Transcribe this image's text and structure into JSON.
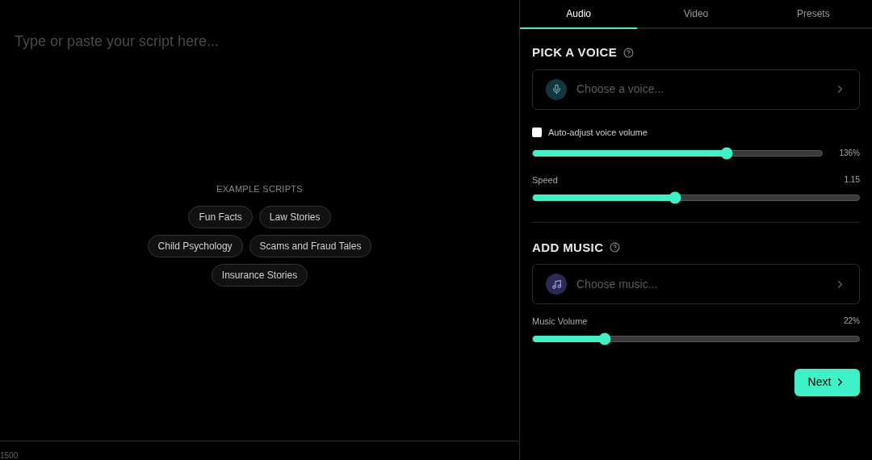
{
  "editor": {
    "placeholder": "Type or paste your script here...",
    "examples_heading": "EXAMPLE SCRIPTS",
    "examples": [
      {
        "label": "Fun Facts"
      },
      {
        "label": "Law Stories"
      },
      {
        "label": "Child Psychology"
      },
      {
        "label": "Scams and Fraud Tales"
      },
      {
        "label": "Insurance Stories"
      }
    ],
    "char_count": "1500"
  },
  "tabs": [
    {
      "label": "Audio",
      "selected": true
    },
    {
      "label": "Video",
      "selected": false
    },
    {
      "label": "Presets",
      "selected": false
    }
  ],
  "voice": {
    "heading": "PICK A VOICE",
    "picker_placeholder": "Choose a voice...",
    "auto_adjust": {
      "label": "Auto-adjust voice volume",
      "checked": false
    },
    "volume": {
      "level": 0.67,
      "reading": "136%"
    },
    "speed": {
      "label": "Speed",
      "level": 0.435,
      "reading": "1.15"
    }
  },
  "music": {
    "heading": "ADD MUSIC",
    "picker_placeholder": "Choose music...",
    "volume": {
      "label": "Music Volume",
      "level": 0.22,
      "reading": "22%"
    }
  },
  "next_button": "Next"
}
